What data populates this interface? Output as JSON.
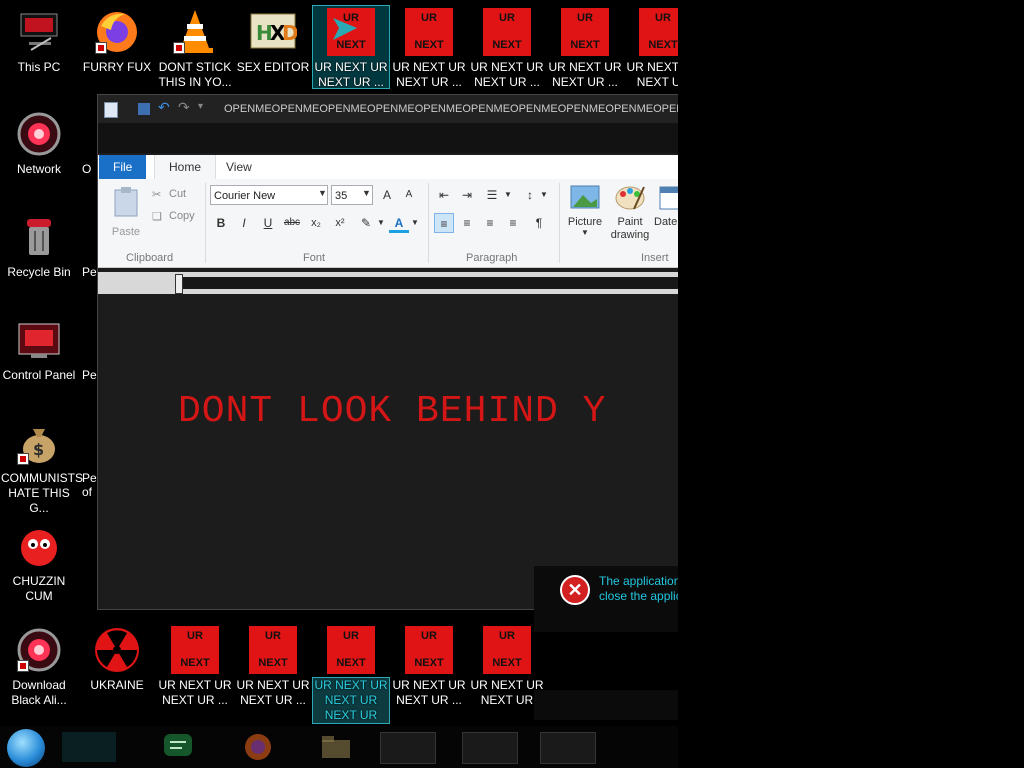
{
  "desktop": {
    "icons_top": [
      {
        "label": "This PC"
      },
      {
        "label": "FURRY FUX"
      },
      {
        "label": "DONT STICK THIS IN YO..."
      },
      {
        "label": "SEX EDITOR"
      },
      {
        "label": "UR NEXT UR NEXT UR ..."
      },
      {
        "label": "UR NEXT UR NEXT UR ..."
      },
      {
        "label": "UR NEXT UR NEXT UR ..."
      },
      {
        "label": "UR NEXT UR NEXT UR ..."
      },
      {
        "label": "UR NEXT UR NEXT UR"
      }
    ],
    "icons_left": [
      {
        "label": "Network"
      },
      {
        "label": "Recycle Bin"
      },
      {
        "label": "Control Panel"
      },
      {
        "label": "COMMUNISTS HATE THIS G..."
      },
      {
        "label": "CHUZZIN CUM"
      }
    ],
    "icons_bottom": [
      {
        "label": "Download Black Ali..."
      },
      {
        "label": "UKRAINE"
      },
      {
        "label": "UR NEXT UR NEXT UR ..."
      },
      {
        "label": "UR NEXT UR NEXT UR ..."
      },
      {
        "label": "UR NEXT UR NEXT UR NEXT UR"
      },
      {
        "label": "UR NEXT UR NEXT UR ..."
      },
      {
        "label": "UR NEXT UR NEXT UR"
      }
    ],
    "partial_labels": [
      "O",
      "Pe",
      "Pe",
      "Pe of",
      "Pe"
    ],
    "ur_box": {
      "top": "UR",
      "bottom": "NEXT"
    }
  },
  "wordpad": {
    "title": "OPENMEOPENMEOPENMEOPENMEOPENMEOPENMEOPENMEOPENMEOPENMEOPENMEOPENMEOPENMEOPENMEOPENME",
    "tabs": {
      "file": "File",
      "home": "Home",
      "view": "View"
    },
    "clipboard": {
      "paste": "Paste",
      "cut": "Cut",
      "copy": "Copy",
      "group": "Clipboard"
    },
    "font": {
      "name": "Courier New",
      "size": "35",
      "group": "Font",
      "bold": "B",
      "italic": "I",
      "underline": "U",
      "strike": "abc",
      "sub": "x₂",
      "sup": "x²",
      "grow": "A",
      "shrink": "A"
    },
    "paragraph": {
      "group": "Paragraph"
    },
    "insert": {
      "picture": "Picture",
      "paint": "Paint drawing",
      "date": "Date ti",
      "group": "Insert"
    },
    "document_text": "DONT LOOK BEHIND Y"
  },
  "error": {
    "line1": "The application",
    "line2": "close the applic"
  },
  "colors": {
    "accent": "#1a6fc7",
    "text_red": "#d41616",
    "ur_red": "#e01414",
    "error_cyan": "#22c8e0"
  }
}
